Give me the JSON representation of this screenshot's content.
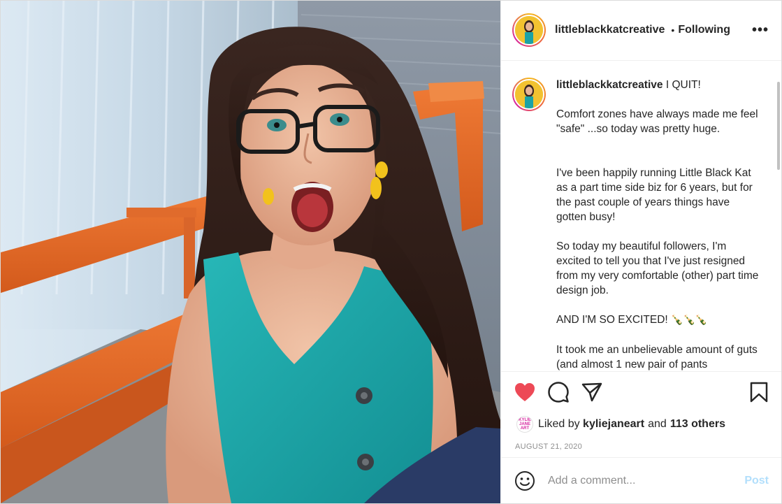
{
  "post": {
    "image_alt": "Woman with glasses and teal top looking surprised on an orange bench"
  },
  "header": {
    "username": "littleblackkatcreative",
    "separator": "•",
    "follow_status": "Following",
    "more_label": "•••"
  },
  "caption": {
    "username": "littleblackkatcreative",
    "paragraphs": [
      "I QUIT!",
      "Comfort zones have always made me feel \"safe\" ...so today was pretty huge.",
      "I've been happily running Little Black Kat as a part time side biz for 6 years, but for the past couple of years things have gotten busy!",
      "So today my beautiful followers, I'm excited to tell you that I've just resigned from my very comfortable (other) part time design job.",
      "AND I'M SO EXCITED!",
      "It took me an unbelievable amount of guts (and almost 1 new pair of pants"
    ],
    "emoji": "🍾🍾🍾"
  },
  "actions": {
    "icons": [
      "heart-icon",
      "comment-icon",
      "share-icon",
      "bookmark-icon"
    ],
    "like_color": "#ed4956"
  },
  "likes": {
    "prefix": "Liked by",
    "user": "kyliejaneart",
    "middle": "and",
    "others": "113 others",
    "avatar_text": "KYLIE JANE ART"
  },
  "date": "AUGUST 21, 2020",
  "comment_box": {
    "placeholder": "Add a comment...",
    "post_label": "Post",
    "post_color": "#b2dffc"
  }
}
